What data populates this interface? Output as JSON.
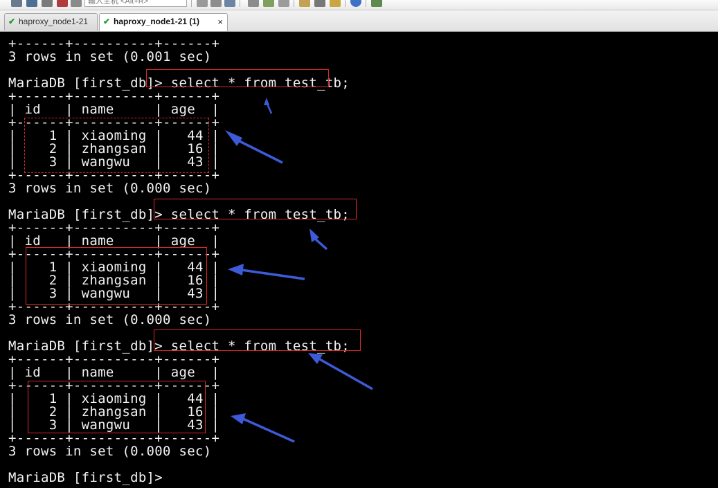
{
  "toolbar": {
    "host_placeholder": "输入主机 <Alt+R>",
    "buttons": [
      "new-session-icon",
      "reconnect-icon",
      "disconnect-icon",
      "close-session-icon",
      "cut-icon",
      "copy-icon",
      "paste-icon",
      "print-icon",
      "properties-icon",
      "tools-icon",
      "key-icon",
      "help-icon",
      "layout-icon"
    ]
  },
  "tabs": [
    {
      "label": "haproxy_node1-21",
      "active": false
    },
    {
      "label": "haproxy_node1-21 (1)",
      "active": true,
      "close": "×"
    }
  ],
  "terminal": {
    "lines": [
      "+------+----------+------+",
      "3 rows in set (0.001 sec)",
      "",
      "MariaDB [first_db]> select * from test_tb;",
      "+------+----------+------+",
      "| id   | name     | age  |",
      "+------+----------+------+",
      "|    1 | xiaoming |   44 |",
      "|    2 | zhangsan |   16 |",
      "|    3 | wangwu   |   43 |",
      "+------+----------+------+",
      "3 rows in set (0.000 sec)",
      "",
      "MariaDB [first_db]> select * from test_tb;",
      "+------+----------+------+",
      "| id   | name     | age  |",
      "+------+----------+------+",
      "|    1 | xiaoming |   44 |",
      "|    2 | zhangsan |   16 |",
      "|    3 | wangwu   |   43 |",
      "+------+----------+------+",
      "3 rows in set (0.000 sec)",
      "",
      "MariaDB [first_db]> select * from test_tb;",
      "+------+----------+------+",
      "| id   | name     | age  |",
      "+------+----------+------+",
      "|    1 | xiaoming |   44 |",
      "|    2 | zhangsan |   16 |",
      "|    3 | wangwu   |   43 |",
      "+------+----------+------+",
      "3 rows in set (0.000 sec)",
      "",
      "MariaDB [first_db]>"
    ]
  },
  "colors": {
    "terminal_bg": "#000000",
    "terminal_fg": "#f2f2f2",
    "highlight_box": "#e02828",
    "annotation_arrow": "#3d5bd9"
  }
}
